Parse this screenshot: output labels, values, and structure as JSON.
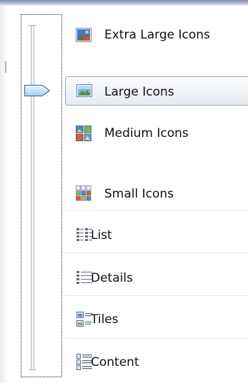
{
  "view_menu": {
    "items": [
      {
        "label": "Extra Large Icons",
        "icon": "extra-large-icons-icon",
        "selected": false
      },
      {
        "label": "Large Icons",
        "icon": "large-icons-icon",
        "selected": true
      },
      {
        "label": "Medium Icons",
        "icon": "medium-icons-icon",
        "selected": false
      },
      {
        "label": "Small Icons",
        "icon": "small-icons-icon",
        "selected": false
      },
      {
        "label": "List",
        "icon": "list-icon",
        "selected": false
      },
      {
        "label": "Details",
        "icon": "details-icon",
        "selected": false
      },
      {
        "label": "Tiles",
        "icon": "tiles-icon",
        "selected": false
      },
      {
        "label": "Content",
        "icon": "content-icon",
        "selected": false
      }
    ]
  },
  "slider": {
    "icon": "slider-thumb-icon",
    "selected_view": "Large Icons"
  },
  "colors": {
    "selection_border": "#9ba6b4",
    "thumb_fill": "#cbe7f7",
    "thumb_border": "#3f79a6"
  }
}
